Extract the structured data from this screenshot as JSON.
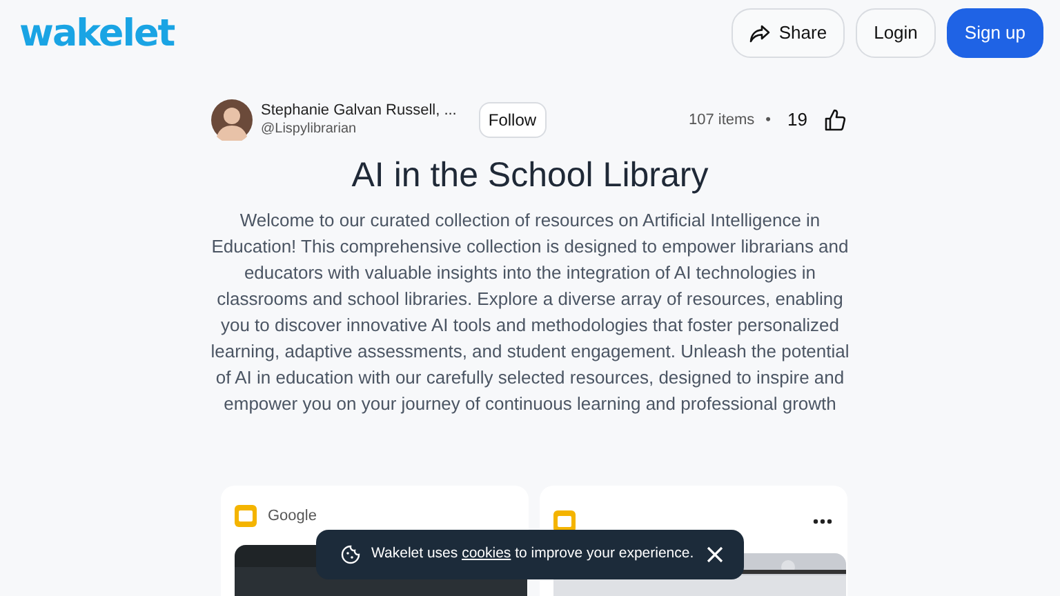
{
  "header": {
    "logo": "wakelet",
    "buttons": [
      {
        "kind": "share",
        "label": "Share"
      },
      {
        "kind": "outline",
        "label": "Login"
      },
      {
        "kind": "primary",
        "label": "Sign up"
      }
    ]
  },
  "author": {
    "name": "Stephanie Galvan Russell, ...",
    "handle": "@Lispylibrarian",
    "follow": "Follow"
  },
  "stats": {
    "items": "107 items",
    "separator": "•",
    "likes": "19"
  },
  "title": "AI in the School Library",
  "description": "Welcome to our curated collection of resources on Artificial Intelligence in Education! This comprehensive collection is designed to empower librarians and educators with valuable insights into the integration of AI technologies in classrooms and school libraries. Explore a diverse array of resources, enabling you to discover innovative AI tools and methodologies that foster personalized learning, adaptive assessments, and student engagement. Unleash the potential of AI in education with our carefully selected resources, designed to inspire and empower you on your journey of continuous learning and professional growth",
  "cards": [
    {
      "source": "Google",
      "more": false
    },
    {
      "more": true
    }
  ],
  "cookie_banner": {
    "before": "Wakelet uses ",
    "link": "cookies",
    "after": " to improve your experience."
  }
}
